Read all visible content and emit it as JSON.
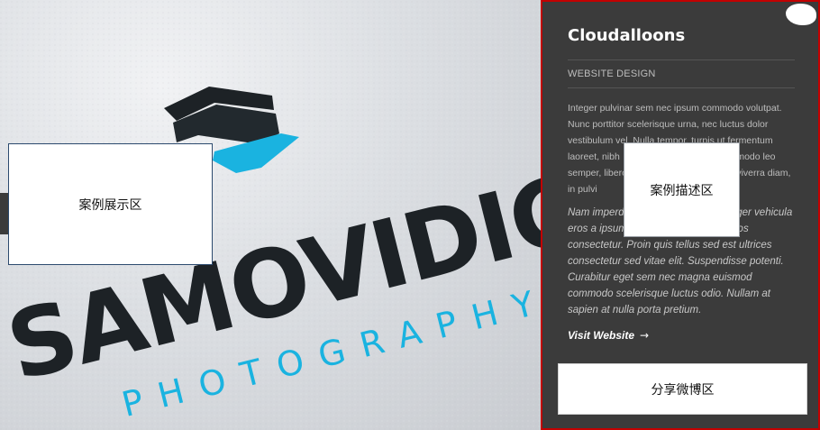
{
  "showcase": {
    "logo_main": "SAMOVIDIC",
    "logo_sub": "PHOTOGRAPHY",
    "overlay_label": "案例展示区",
    "colors": {
      "accent": "#1ab3e0",
      "dark": "#1d2226"
    }
  },
  "panel": {
    "title": "Cloudalloons",
    "category": "WEBSITE DESIGN",
    "paragraph1": "Integer pulvinar sem nec ipsum commodo volutpat. Nunc porttitor scelerisque urna, nec luctus dolor vestibulum vel. Nulla tempor, turpis ut fermentum laoreet, nibh                              quis commodo leo                              semper, libero sed ve                              viverra diam, in pulvi",
    "paragraph2": "Nam imperd                                    teger vehicula eros a ipsum adipiscing et ultricies eros consectetur. Proin quis tellus sed est ultrices consectetur sed vitae elit. Suspendisse potenti. Curabitur eget sem nec magna euismod commodo scelerisque luctus odio. Nullam at sapien at nulla porta pretium.",
    "visit_label": "Visit Website",
    "visit_arrow": "→",
    "overlay_label": "案例描述区",
    "colors": {
      "background": "#3b3b3b",
      "border": "#c20000"
    }
  },
  "share": {
    "overlay_label": "分享微博区"
  }
}
